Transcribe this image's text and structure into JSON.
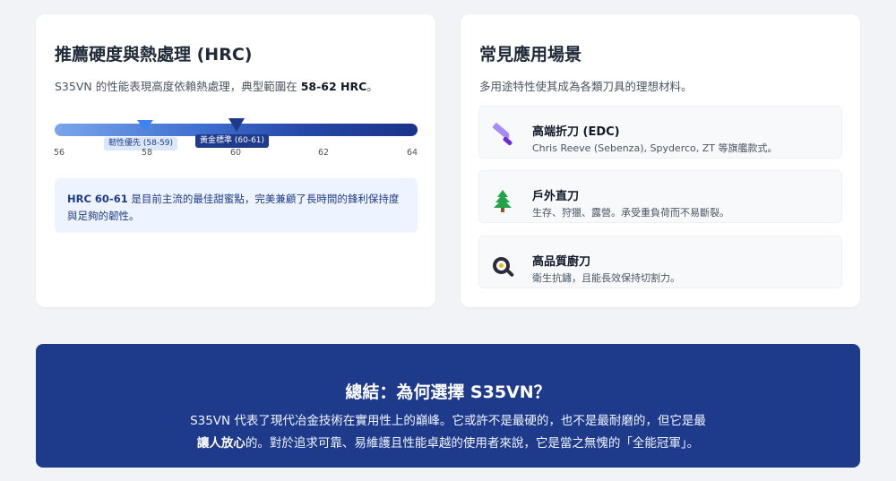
{
  "hardness_card": {
    "title": "推薦硬度與熱處理 (HRC)",
    "subtitle_prefix": "S35VN 的性能表現高度依賴熱處理，典型範圍在 ",
    "subtitle_bold": "58-62 HRC",
    "subtitle_suffix": "。",
    "scale": {
      "ticks": [
        "56",
        "58",
        "60",
        "62",
        "64"
      ],
      "range": [
        56,
        64
      ],
      "marker_toughness_label": "韌性優先 (58-59)",
      "marker_standard_label": "黃金標準 (60-61)",
      "colors": {
        "start": "#7aa6ea",
        "end": "#1a3388",
        "toughness": "#3b82f6",
        "standard": "#1e3a8a"
      }
    },
    "note_bold": "HRC 60-61",
    "note_text": " 是目前主流的最佳甜蜜點，完美兼顧了長時間的鋒利保持度與足夠的韌性。"
  },
  "scenarios_card": {
    "title": "常見應用場景",
    "subtitle": "多用途特性使其成為各類刀具的理想材料。",
    "items": [
      {
        "icon": "knife-icon",
        "title": "高端折刀 (EDC)",
        "desc": "Chris Reeve (Sebenza), Spyderco, ZT 等旗艦款式。"
      },
      {
        "icon": "tree-icon",
        "title": "戶外直刀",
        "desc": "生存、狩獵、露營。承受重負荷而不易斷裂。"
      },
      {
        "icon": "frying-pan-icon",
        "title": "高品質廚刀",
        "desc": "衛生抗鏽，且能長效保持切割力。"
      }
    ]
  },
  "summary": {
    "title": "總結：為何選擇 S35VN？",
    "line1": "S35VN 代表了現代冶金技術在實用性上的巔峰。它或許不是最硬的，也不是最耐磨的，但它是最",
    "line2_bold": "讓人放心",
    "line2_rest": "的。對於追求可靠、易維護且性能卓越的使用者來說，它是當之無愧的「全能冠軍」。",
    "colors": {
      "background": "#1e3a8a",
      "text": "#ffffff"
    }
  }
}
